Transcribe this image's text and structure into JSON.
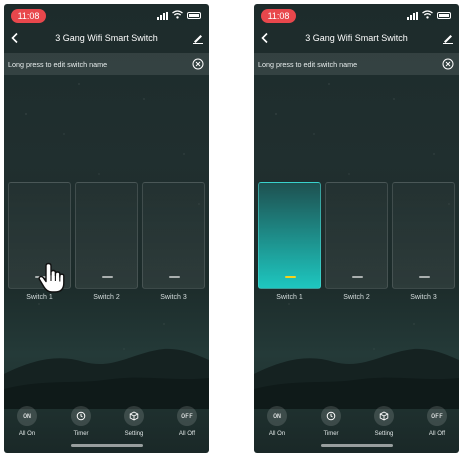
{
  "status_bar": {
    "time": "11:08"
  },
  "nav": {
    "title": "3 Gang Wifi Smart Switch"
  },
  "hint": {
    "text": "Long press to edit switch name"
  },
  "switches": [
    {
      "label": "Switch 1"
    },
    {
      "label": "Switch 2"
    },
    {
      "label": "Switch 3"
    }
  ],
  "screens": {
    "left": {
      "switch_states": [
        "off",
        "off",
        "off"
      ],
      "pointer": "hand-pointer-icon"
    },
    "right": {
      "switch_states": [
        "on",
        "off",
        "off"
      ]
    }
  },
  "bottom_bar": {
    "all_on": {
      "icon_text": "ON",
      "label": "All On"
    },
    "timer": {
      "icon": "clock-icon",
      "label": "Timer"
    },
    "setting": {
      "icon": "cube-icon",
      "label": "Setting"
    },
    "all_off": {
      "icon_text": "OFF",
      "label": "All Off"
    }
  },
  "colors": {
    "time_pill": "#e8474c",
    "switch_on": "#1ec7c0",
    "switch_on_indicator": "#f6d21b",
    "background": "#1d2b2b"
  }
}
